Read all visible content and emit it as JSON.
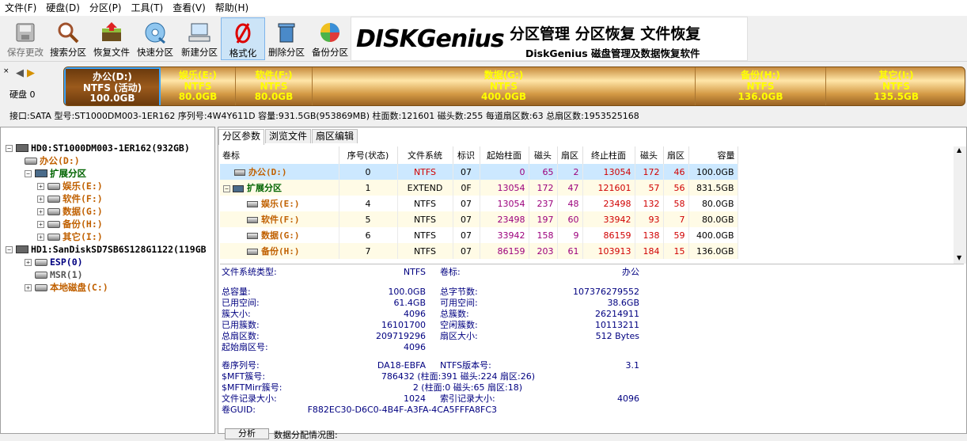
{
  "menu": [
    "文件(F)",
    "硬盘(D)",
    "分区(P)",
    "工具(T)",
    "查看(V)",
    "帮助(H)"
  ],
  "toolbar": [
    {
      "label": "保存更改",
      "icon": "save-icon"
    },
    {
      "label": "搜索分区",
      "icon": "magnifier-icon"
    },
    {
      "label": "恢复文件",
      "icon": "recover-icon"
    },
    {
      "label": "快速分区",
      "icon": "disc-icon"
    },
    {
      "label": "新建分区",
      "icon": "computer-icon"
    },
    {
      "label": "格式化",
      "icon": "format-icon"
    },
    {
      "label": "删除分区",
      "icon": "trash-icon"
    },
    {
      "label": "备份分区",
      "icon": "backup-icon"
    }
  ],
  "banner": {
    "logo": "DISKGenius",
    "title": "分区管理 分区恢复 文件恢复",
    "subtitle": "DiskGenius 磁盘管理及数据恢复软件"
  },
  "disk_label": "硬盘 0",
  "partitions_bar": [
    {
      "name": "办公(D:)",
      "fs": "NTFS (活动)",
      "size": "100.0GB"
    },
    {
      "name": "娱乐(E:)",
      "fs": "NTFS",
      "size": "80.0GB"
    },
    {
      "name": "软件(F:)",
      "fs": "NTFS",
      "size": "80.0GB"
    },
    {
      "name": "数据(G:)",
      "fs": "NTFS",
      "size": "400.0GB"
    },
    {
      "name": "备份(H:)",
      "fs": "NTFS",
      "size": "136.0GB"
    },
    {
      "name": "其它(I:)",
      "fs": "NTFS",
      "size": "135.5GB"
    }
  ],
  "infobar": "接口:SATA  型号:ST1000DM003-1ER162  序列号:4W4Y611D  容量:931.5GB(953869MB)  柱面数:121601  磁头数:255  每道扇区数:63  总扇区数:1953525168",
  "tree": {
    "hd0": "HD0:ST1000DM003-1ER162(932GB)",
    "hd0_children": [
      "办公(D:)",
      "扩展分区",
      "娱乐(E:)",
      "软件(F:)",
      "数据(G:)",
      "备份(H:)",
      "其它(I:)"
    ],
    "hd1": "HD1:SanDiskSD7SB6S128G1122(119GB",
    "hd1_children": [
      "ESP(0)",
      "MSR(1)",
      "本地磁盘(C:)"
    ]
  },
  "tabs": [
    "分区参数",
    "浏览文件",
    "扇区编辑"
  ],
  "table": {
    "headers": [
      "卷标",
      "序号(状态)",
      "文件系统",
      "标识",
      "起始柱面",
      "磁头",
      "扇区",
      "终止柱面",
      "磁头",
      "扇区",
      "容量"
    ],
    "rows": [
      [
        "办公(D:)",
        "0",
        "NTFS",
        "07",
        "0",
        "65",
        "2",
        "13054",
        "172",
        "46",
        "100.0GB"
      ],
      [
        "扩展分区",
        "1",
        "EXTEND",
        "0F",
        "13054",
        "172",
        "47",
        "121601",
        "57",
        "56",
        "831.5GB"
      ],
      [
        "娱乐(E:)",
        "4",
        "NTFS",
        "07",
        "13054",
        "237",
        "48",
        "23498",
        "132",
        "58",
        "80.0GB"
      ],
      [
        "软件(F:)",
        "5",
        "NTFS",
        "07",
        "23498",
        "197",
        "60",
        "33942",
        "93",
        "7",
        "80.0GB"
      ],
      [
        "数据(G:)",
        "6",
        "NTFS",
        "07",
        "33942",
        "158",
        "9",
        "86159",
        "138",
        "59",
        "400.0GB"
      ],
      [
        "备份(H:)",
        "7",
        "NTFS",
        "07",
        "86159",
        "203",
        "61",
        "103913",
        "184",
        "15",
        "136.0GB"
      ]
    ]
  },
  "details": {
    "fs_type_label": "文件系统类型:",
    "fs_type": "NTFS",
    "vol_label_label": "卷标:",
    "vol_label": "办公",
    "left": [
      [
        "总容量:",
        "100.0GB"
      ],
      [
        "已用空间:",
        "61.4GB"
      ],
      [
        "簇大小:",
        "4096"
      ],
      [
        "已用簇数:",
        "16101700"
      ],
      [
        "总扇区数:",
        "209719296"
      ],
      [
        "起始扇区号:",
        "4096"
      ]
    ],
    "right": [
      [
        "总字节数:",
        "107376279552"
      ],
      [
        "可用空间:",
        "38.6GB"
      ],
      [
        "总簇数:",
        "26214911"
      ],
      [
        "空闲簇数:",
        "10113211"
      ],
      [
        "扇区大小:",
        "512 Bytes"
      ]
    ],
    "serial_label": "卷序列号:",
    "serial": "DA18-EBFA",
    "ntfs_ver_label": "NTFS版本号:",
    "ntfs_ver": "3.1",
    "mft_label": "$MFT簇号:",
    "mft": "786432 (柱面:391 磁头:224 扇区:26)",
    "mftmirr_label": "$MFTMirr簇号:",
    "mftmirr": "2 (柱面:0 磁头:65 扇区:18)",
    "rec_label": "文件记录大小:",
    "rec": "1024",
    "idx_label": "索引记录大小:",
    "idx": "4096",
    "guid_label": "卷GUID:",
    "guid": "F882EC30-D6C0-4B4F-A3FA-4CA5FFFA8FC3"
  },
  "bottom": {
    "button": "分析",
    "text": "数据分配情况图:"
  }
}
